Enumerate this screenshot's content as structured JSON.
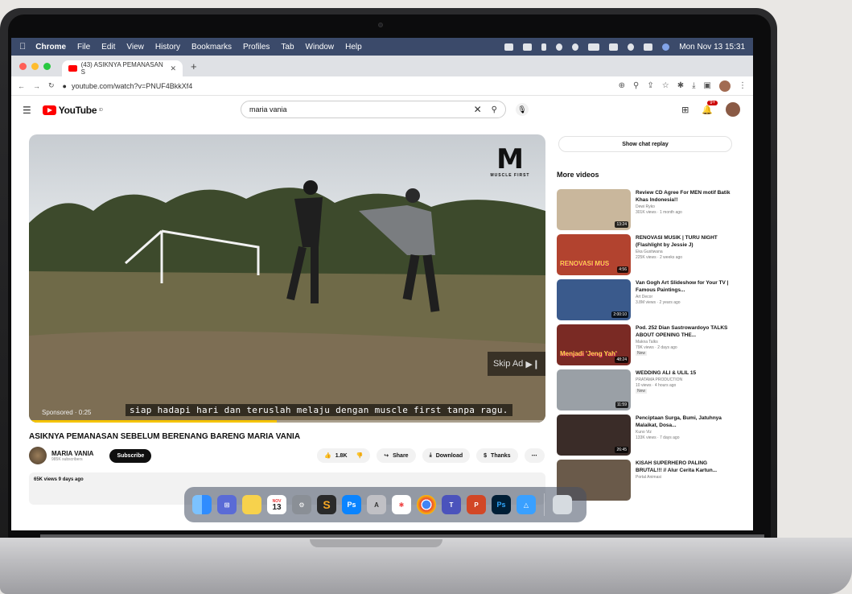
{
  "menubar": {
    "app": "Chrome",
    "items": [
      "File",
      "Edit",
      "View",
      "History",
      "Bookmarks",
      "Profiles",
      "Tab",
      "Window",
      "Help"
    ],
    "clock": "Mon Nov 13  15:31"
  },
  "browser": {
    "tab_title": "(43) ASIKNYA PEMANASAN S",
    "url": "youtube.com/watch?v=PNUF4BkkXf4"
  },
  "youtube": {
    "logo": "YouTube",
    "logo_sup": "ID",
    "search_value": "maria vania",
    "notif_count": "9+"
  },
  "video": {
    "brand_letter": "M",
    "brand_sub": "MUSCLE FIRST",
    "skip_ad": "Skip Ad",
    "sponsored": "Sponsored · 0:25",
    "subtitle": "siap hadapi hari dan teruslah melaju dengan muscle first tanpa ragu.",
    "ad_progress": 0.48,
    "title": "ASIKNYA PEMANASAN SEBELUM BERENANG BARENG MARIA VANIA",
    "channel": "MARIA VANIA",
    "subscribers": "985K subscribers",
    "subscribe_label": "Subscribe",
    "likes": "1.8K",
    "share_label": "Share",
    "download_label": "Download",
    "thanks_label": "Thanks",
    "views_date": "65K views  9 days ago"
  },
  "sidebar": {
    "chat_replay": "Show chat replay",
    "more_videos": "More videos",
    "items": [
      {
        "title": "Review CD Agree For MEN motif Batik Khas Indonesia!!",
        "channel": "Dewi Ryko",
        "meta": "301K views · 1 month ago",
        "duration": "13:24",
        "new": "",
        "thumb_text": "",
        "color": "#c9b79c"
      },
      {
        "title": "RENOVASI MUSIK | TURU NIGHT (Flashlight by Jessie J)",
        "channel": "Eka Gustiwana",
        "meta": "225K views · 2 weeks ago",
        "duration": "4:56",
        "new": "",
        "thumb_text": "RENOVASI MUS",
        "color": "#b2432f"
      },
      {
        "title": "Van Gogh Art Slideshow for Your TV | Famous Paintings...",
        "channel": "Art Decor",
        "meta": "3.8M views · 2 years ago",
        "duration": "2:00:10",
        "new": "",
        "thumb_text": "",
        "color": "#3a5a8c"
      },
      {
        "title": "Pod. 252 Dian Sastrowardoyo TALKS ABOUT OPENING THE...",
        "channel": "Makna Talks",
        "meta": "79K views · 2 days ago",
        "duration": "48:24",
        "new": "New",
        "thumb_text": "Menjadi 'Jeng Yah'",
        "color": "#7a2a24"
      },
      {
        "title": "WEDDING ALI & ULIL 15",
        "channel": "PRATAMA PRODUCTION",
        "meta": "10 views · 4 hours ago",
        "duration": "11:59",
        "new": "New",
        "thumb_text": "",
        "color": "#9aa0a6"
      },
      {
        "title": "Penciptaan Surga, Bumi, Jatuhnya Malaikat, Dosa...",
        "channel": "Kuno Viz",
        "meta": "133K views · 7 days ago",
        "duration": "26:45",
        "new": "",
        "thumb_text": "",
        "color": "#3a2c28"
      },
      {
        "title": "KISAH SUPERHERO PALING BRUTAL!!! // Alur Cerita Kartun...",
        "channel": "Portal Animasi",
        "meta": "",
        "duration": "",
        "new": "",
        "thumb_text": "",
        "color": "#6a5a4a"
      }
    ]
  },
  "dock": {
    "calendar_day": "13",
    "calendar_month": "NOV",
    "ps_label": "Ps",
    "text_label": "A"
  }
}
